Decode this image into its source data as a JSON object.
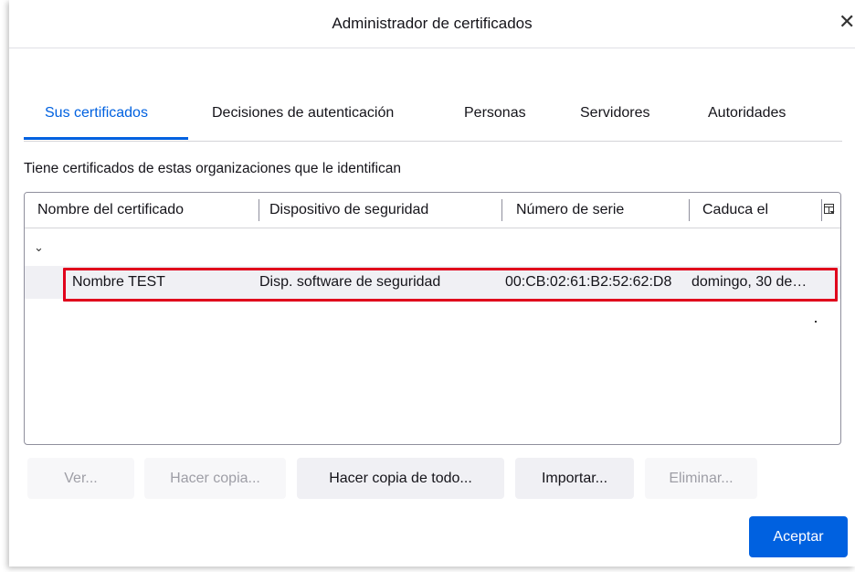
{
  "dialog": {
    "title": "Administrador de certificados",
    "close_glyph": "✕",
    "close_icon": "close-icon"
  },
  "tabs": [
    {
      "label": "Sus certificados",
      "active": true
    },
    {
      "label": "Decisiones de autenticación",
      "active": false
    },
    {
      "label": "Personas",
      "active": false
    },
    {
      "label": "Servidores",
      "active": false
    },
    {
      "label": "Autoridades",
      "active": false
    }
  ],
  "description": "Tiene certificados de estas organizaciones que le identifican",
  "table": {
    "columns": [
      "Nombre del certificado",
      "Dispositivo de seguridad",
      "Número de serie",
      "Caduca el"
    ],
    "column_picker_icon": "column-picker-icon",
    "group_chevron": "⌄",
    "rows": [
      {
        "name": "Nombre TEST",
        "device": "Disp. software de seguridad",
        "serial": "00:CB:02:61:B2:52:62:D8",
        "expires": "domingo, 30 de…"
      }
    ]
  },
  "buttons": {
    "view": {
      "label": "Ver...",
      "enabled": false
    },
    "backup": {
      "label": "Hacer copia...",
      "enabled": false
    },
    "backup_all": {
      "label": "Hacer copia de todo...",
      "enabled": true
    },
    "import": {
      "label": "Importar...",
      "enabled": true
    },
    "delete": {
      "label": "Eliminar...",
      "enabled": false
    },
    "ok": {
      "label": "Aceptar",
      "enabled": true
    }
  },
  "colors": {
    "accent": "#0061e0",
    "highlight_border": "#e0001b",
    "disabled_text": "#9e9ea6"
  }
}
